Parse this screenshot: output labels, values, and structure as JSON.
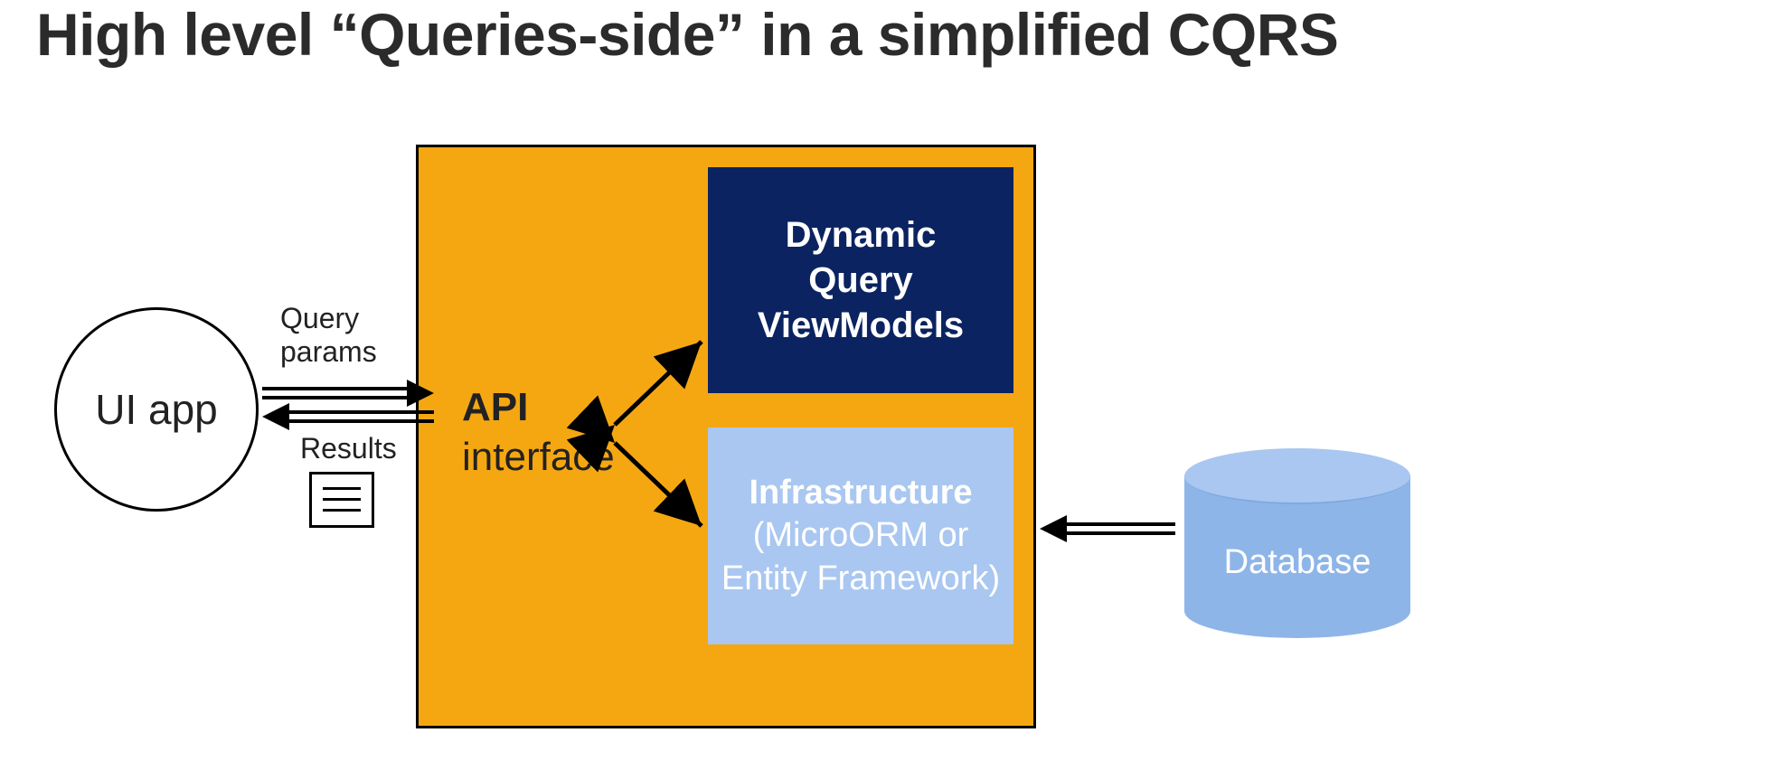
{
  "title": "High level “Queries-side” in a simplified CQRS",
  "ui_app": {
    "label": "UI app"
  },
  "arrows": {
    "query_params": "Query\nparams",
    "results": "Results"
  },
  "api": {
    "title": "API",
    "subtitle": "interface",
    "viewmodels": {
      "line1": "Dynamic",
      "line2": "Query",
      "line3": "ViewModels"
    },
    "infrastructure": {
      "title": "Infrastructure",
      "sub1": "(MicroORM or",
      "sub2": "Entity Framework)"
    }
  },
  "database": {
    "label": "Database"
  },
  "colors": {
    "api_bg": "#F5A712",
    "vm_bg": "#0B2360",
    "infra_bg": "#A9C7F0",
    "db_fill": "#8EB5E8"
  }
}
